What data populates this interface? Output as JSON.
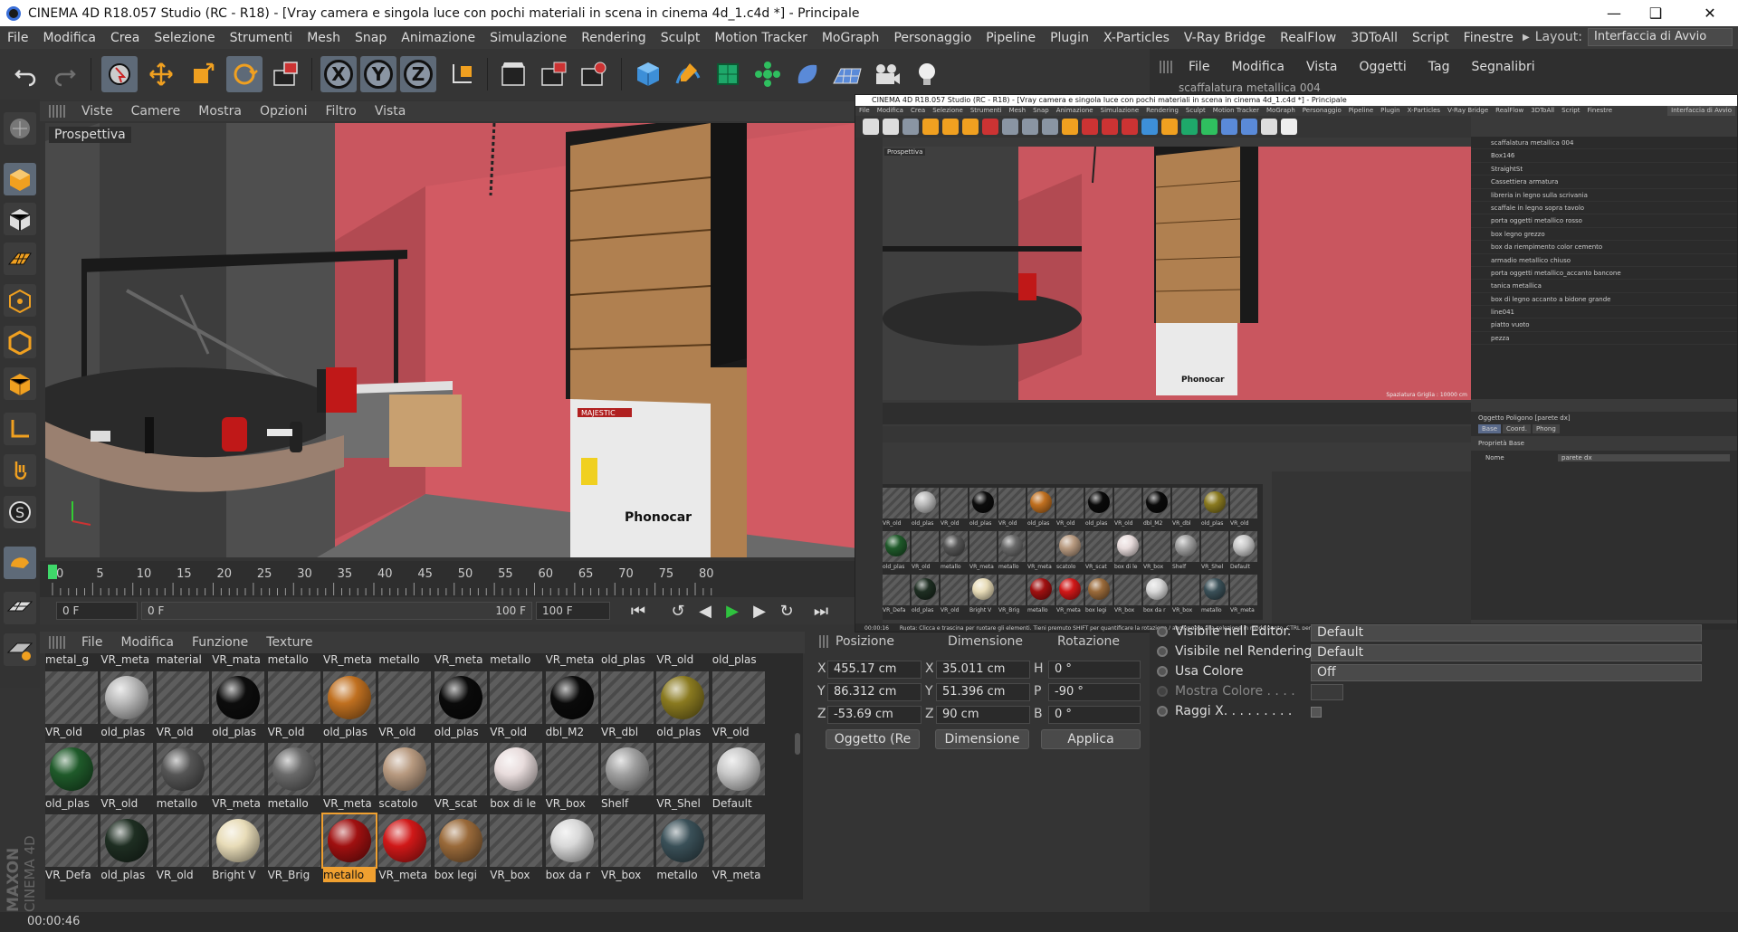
{
  "window": {
    "title": "CINEMA 4D R18.057 Studio (RC - R18) - [Vray camera e singola luce con pochi materiali in scena in cinema 4d_1.c4d *] - Principale"
  },
  "menubar": {
    "items": [
      "File",
      "Modifica",
      "Crea",
      "Selezione",
      "Strumenti",
      "Mesh",
      "Snap",
      "Animazione",
      "Simulazione",
      "Rendering",
      "Sculpt",
      "Motion Tracker",
      "MoGraph",
      "Personaggio",
      "Pipeline",
      "Plugin",
      "X-Particles",
      "V-Ray Bridge",
      "RealFlow",
      "3DToAll",
      "Script",
      "Finestre"
    ],
    "layout_label": "Layout:",
    "layout_value": "Interfaccia di Avvio"
  },
  "toolbar": {
    "axis_x": "X",
    "axis_y": "Y",
    "axis_z": "Z"
  },
  "viewport": {
    "menu": [
      "Viste",
      "Camere",
      "Mostra",
      "Opzioni",
      "Filtro",
      "Vista"
    ],
    "label": "Prospettiva"
  },
  "timeline": {
    "ticks": [
      "0",
      "5",
      "10",
      "15",
      "20",
      "25",
      "30",
      "35",
      "40",
      "45",
      "50",
      "55",
      "60",
      "65",
      "70",
      "75",
      "80"
    ],
    "current_frame": "0 F",
    "range_start": "0 F",
    "range_end": "100 F",
    "max_frame": "100 F"
  },
  "material_manager": {
    "menu": [
      "File",
      "Modifica",
      "Funzione",
      "Texture"
    ],
    "top_row_labels": [
      "metal_g",
      "VR_meta",
      "material",
      "VR_mata",
      "metallo",
      "VR_meta",
      "metallo",
      "VR_meta",
      "metallo",
      "VR_meta",
      "old_plas",
      "VR_old",
      "old_plas"
    ],
    "rows": [
      [
        {
          "label": "VR_old",
          "ball": ""
        },
        {
          "label": "old_plas",
          "ball": "#b9b9b9"
        },
        {
          "label": "VR_old",
          "ball": ""
        },
        {
          "label": "old_plas",
          "ball": "#0d0d0d"
        },
        {
          "label": "VR_old",
          "ball": ""
        },
        {
          "label": "old_plas",
          "ball": "#c07020"
        },
        {
          "label": "VR_old",
          "ball": ""
        },
        {
          "label": "old_plas",
          "ball": "#0a0a0a"
        },
        {
          "label": "VR_old",
          "ball": ""
        },
        {
          "label": "dbl_M2",
          "ball": "#0a0a0a"
        },
        {
          "label": "VR_dbl",
          "ball": ""
        },
        {
          "label": "old_plas",
          "ball": "#8a7a20"
        },
        {
          "label": "VR_old",
          "ball": ""
        }
      ],
      [
        {
          "label": "old_plas",
          "ball": "#1f5a2a"
        },
        {
          "label": "VR_old",
          "ball": ""
        },
        {
          "label": "metallo",
          "ball": "#555555"
        },
        {
          "label": "VR_meta",
          "ball": ""
        },
        {
          "label": "metallo",
          "ball": "#6a6a6a"
        },
        {
          "label": "VR_meta",
          "ball": ""
        },
        {
          "label": "scatolo",
          "ball": "#b89a80"
        },
        {
          "label": "VR_scat",
          "ball": ""
        },
        {
          "label": "box di le",
          "ball": "#e8dcdc"
        },
        {
          "label": "VR_box",
          "ball": ""
        },
        {
          "label": "Shelf",
          "ball": "#a0a0a0"
        },
        {
          "label": "VR_Shel",
          "ball": ""
        },
        {
          "label": "Default",
          "ball": "#c8c8c8"
        }
      ],
      [
        {
          "label": "VR_Defa",
          "ball": ""
        },
        {
          "label": "old_plas",
          "ball": "#1e2e22"
        },
        {
          "label": "VR_old",
          "ball": ""
        },
        {
          "label": "Bright V",
          "ball": "#e8dcb8"
        },
        {
          "label": "VR_Brig",
          "ball": ""
        },
        {
          "label": "metallo",
          "ball": "#a01010",
          "active": true
        },
        {
          "label": "VR_meta",
          "ball": "#d01818"
        },
        {
          "label": "box legi",
          "ball": "#9a6a3a"
        },
        {
          "label": "VR_box",
          "ball": ""
        },
        {
          "label": "box da r",
          "ball": "#d8d8d8"
        },
        {
          "label": "VR_box",
          "ball": ""
        },
        {
          "label": "metallo",
          "ball": "#3a5058"
        },
        {
          "label": "VR_meta",
          "ball": ""
        }
      ]
    ]
  },
  "coordinates": {
    "col_position": "Posizione",
    "col_size": "Dimensione",
    "col_rotation": "Rotazione",
    "rows": [
      {
        "axis": "X",
        "pos": "455.17 cm",
        "size": "35.011 cm",
        "rot_axis": "H",
        "rot": "0 °"
      },
      {
        "axis": "Y",
        "pos": "86.312 cm",
        "size": "51.396 cm",
        "rot_axis": "P",
        "rot": "-90 °"
      },
      {
        "axis": "Z",
        "pos": "-53.69 cm",
        "size": "90 cm",
        "rot_axis": "B",
        "rot": "0 °"
      }
    ],
    "mode_object": "Oggetto (Re",
    "mode_size": "Dimensione",
    "apply": "Applica"
  },
  "object_manager": {
    "menu": [
      "File",
      "Modifica",
      "Vista",
      "Oggetti",
      "Tag",
      "Segnalibri"
    ],
    "first_item": "scaffalatura metallica 004"
  },
  "attributes": {
    "rows": [
      {
        "label": "Visibile nell Editor.",
        "value": "Default"
      },
      {
        "label": "Visibile nel Rendering",
        "value": "Default"
      },
      {
        "label": "Usa Colore",
        "value": "Off"
      },
      {
        "label": "Mostra Colore . . . .",
        "value": ""
      },
      {
        "label": "Raggi X. . . . . . . . .",
        "value": ""
      }
    ]
  },
  "embedded": {
    "title": "CINEMA 4D R18.057 Studio (RC - R18) - [Vray camera e singola luce con pochi materiali in scena in cinema 4d_1.c4d *] - Principale",
    "menu": [
      "File",
      "Modifica",
      "Crea",
      "Selezione",
      "Strumenti",
      "Mesh",
      "Snap",
      "Animazione",
      "Simulazione",
      "Rendering",
      "Sculpt",
      "Motion Tracker",
      "MoGraph",
      "Personaggio",
      "Pipeline",
      "Plugin",
      "X-Particles",
      "V-Ray Bridge",
      "RealFlow",
      "3DToAll",
      "Script",
      "Finestre"
    ],
    "layout_value": "Interfaccia di Avvio",
    "viewport_label": "Prospettiva",
    "grid_text": "Spaziatura Griglia : 10000 cm",
    "objects": [
      "scaffalatura metallica 004",
      "Box146",
      "StraightSt",
      "Cassettiera armatura",
      "libreria in legno sulla scrivania",
      "scaffale in legno sopra tavolo",
      "porta oggetti metallico rosso",
      "box legno grezzo",
      "box da riempimento color cemento",
      "armadio metallico chiuso",
      "porta oggetti metallico_accanto bancone",
      "tanica metallica",
      "box di legno accanto a bidone grande",
      "line041",
      "piatto vuoto",
      "pezza"
    ],
    "attr_title": "Oggetto Poligono [parete dx]",
    "attr_tabs": [
      "Base",
      "Coord.",
      "Phong"
    ],
    "attr_section": "Proprietà Base",
    "attr_name_label": "Nome",
    "attr_name_value": "parete dx",
    "status": "Ruota: Clicca e trascina per ruotare gli elementi. Tieni premuto SHIFT per quantificare la rotazione / aggiungere alla selezione in modo punto. CTRL per rimuovere.",
    "time": "00:00:16"
  },
  "status": {
    "time": "00:00:46"
  },
  "brand": {
    "maxon": "MAXON",
    "c4d": "CINEMA 4D"
  },
  "scene": {
    "box_brand": "Phonocar",
    "box_label": "MAJESTIC"
  }
}
